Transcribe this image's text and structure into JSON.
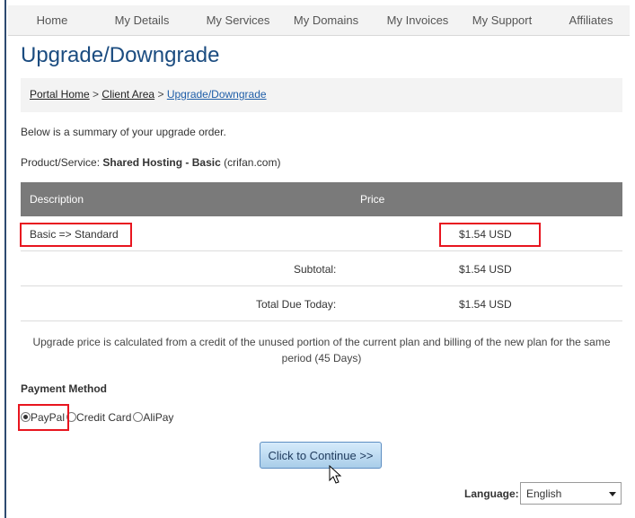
{
  "nav": {
    "items": [
      {
        "label": "Home"
      },
      {
        "label": "My Details"
      },
      {
        "label": "My Services"
      },
      {
        "label": "My Domains"
      },
      {
        "label": "My Invoices"
      },
      {
        "label": "My Support"
      },
      {
        "label": "Affiliates"
      }
    ]
  },
  "page_title": "Upgrade/Downgrade",
  "breadcrumb": {
    "items": [
      {
        "label": "Portal Home"
      },
      {
        "label": "Client Area"
      },
      {
        "label": "Upgrade/Downgrade"
      }
    ],
    "separator": ">"
  },
  "summary_text": "Below is a summary of your upgrade order.",
  "product": {
    "label": "Product/Service:",
    "name": "Shared Hosting - Basic",
    "domain": "(crifan.com)"
  },
  "table": {
    "headers": {
      "description": "Description",
      "price": "Price"
    },
    "item": {
      "description": "Basic => Standard",
      "price": "$1.54 USD"
    },
    "subtotal": {
      "label": "Subtotal:",
      "value": "$1.54 USD"
    },
    "total": {
      "label": "Total Due Today:",
      "value": "$1.54 USD"
    }
  },
  "note": "Upgrade price is calculated from a credit of the unused portion of the current plan and billing of the new plan for the same period (45 Days)",
  "payment": {
    "label": "Payment Method",
    "options": [
      {
        "label": "PayPal",
        "selected": true
      },
      {
        "label": "Credit Card",
        "selected": false
      },
      {
        "label": "AliPay",
        "selected": false
      }
    ]
  },
  "continue_button": "Click to Continue >>",
  "language": {
    "label": "Language:",
    "selected": "English"
  },
  "colors": {
    "title": "#1b4c80",
    "highlight": "#e8151f",
    "table_header": "#7a7a7a"
  }
}
